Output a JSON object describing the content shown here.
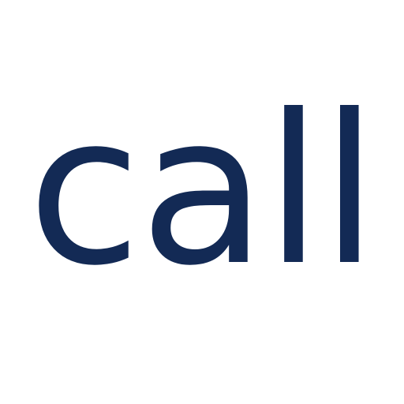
{
  "word": {
    "text": "call",
    "color": "#132a55"
  },
  "background": "#ffffff"
}
